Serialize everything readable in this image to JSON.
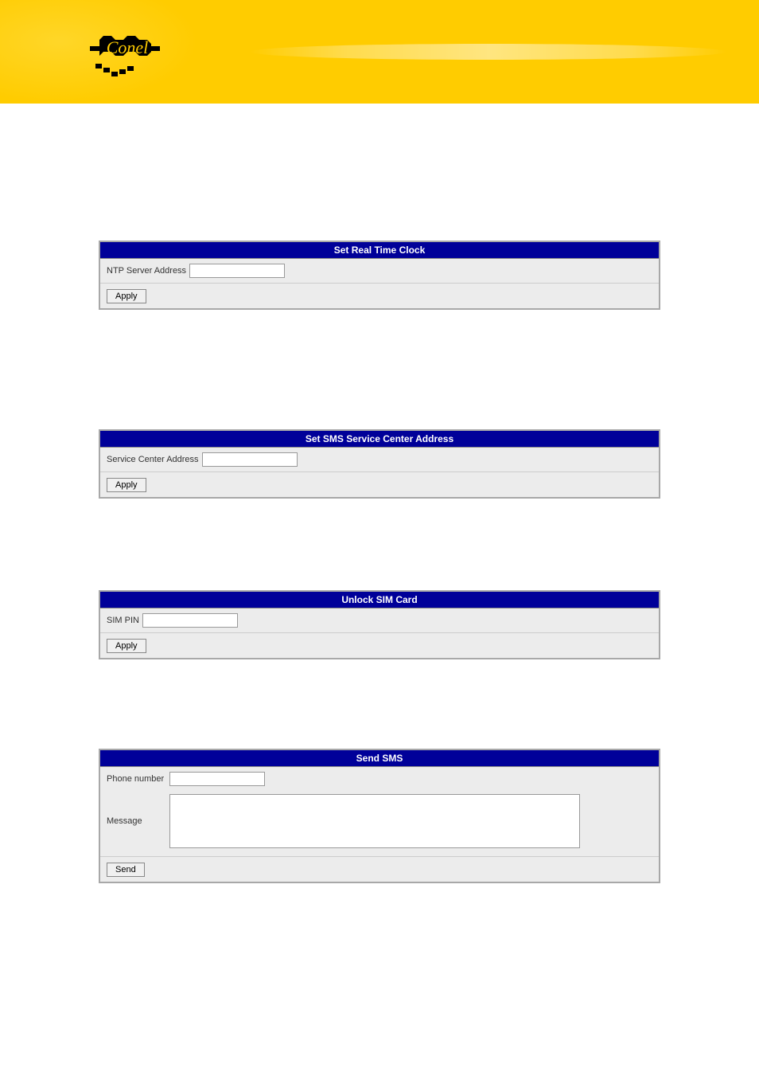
{
  "brand": "Conel",
  "panels": {
    "rtc": {
      "title": "Set Real Time Clock",
      "field_label": "NTP Server Address",
      "button": "Apply"
    },
    "smsc": {
      "title": "Set SMS Service Center Address",
      "field_label": "Service Center Address",
      "button": "Apply"
    },
    "sim": {
      "title": "Unlock SIM Card",
      "field_label": "SIM PIN",
      "button": "Apply"
    },
    "sendsms": {
      "title": "Send SMS",
      "phone_label": "Phone number",
      "message_label": "Message",
      "button": "Send"
    }
  }
}
